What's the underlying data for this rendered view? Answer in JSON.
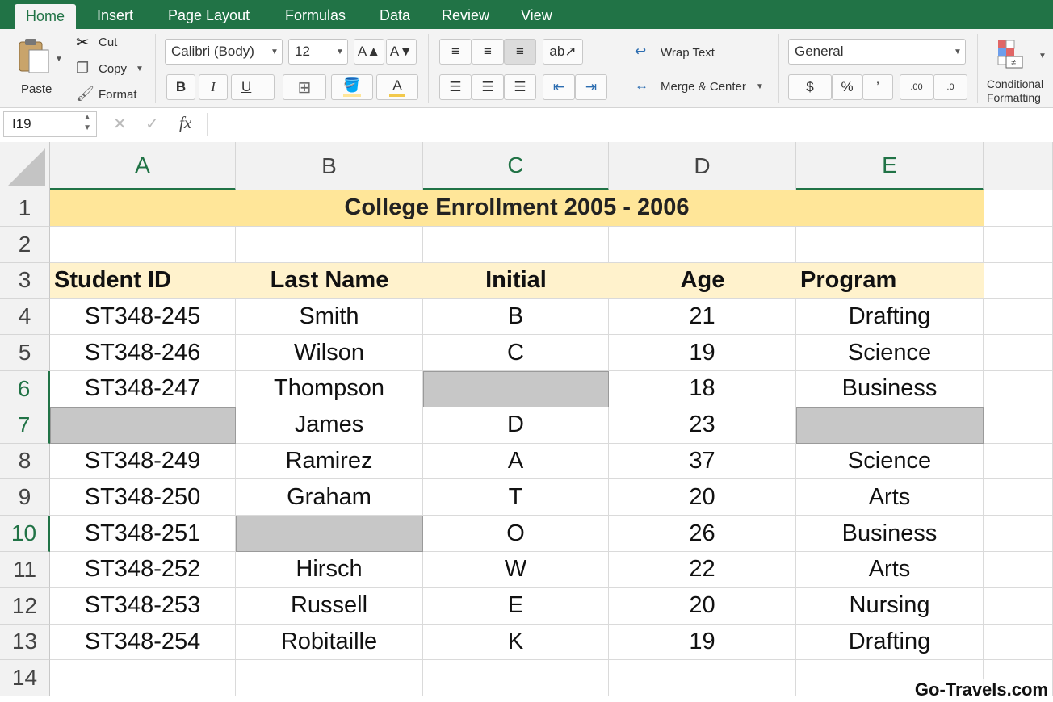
{
  "tabs": [
    "Home",
    "Insert",
    "Page Layout",
    "Formulas",
    "Data",
    "Review",
    "View"
  ],
  "active_tab": "Home",
  "ribbon": {
    "paste_label": "Paste",
    "cut_label": "Cut",
    "copy_label": "Copy",
    "format_label": "Format",
    "font_name": "Calibri (Body)",
    "font_size": "12",
    "bold_label": "B",
    "italic_label": "I",
    "underline_label": "U",
    "wrap_text_label": "Wrap Text",
    "merge_center_label": "Merge & Center",
    "number_format": "General",
    "currency_label": "$",
    "percent_label": "%",
    "comma_label": "’",
    "inc_decimal_label": ".00",
    "dec_decimal_label": ".0",
    "conditional_label_1": "Conditional",
    "conditional_label_2": "Formatting"
  },
  "formula_bar": {
    "name_box": "I19",
    "fx_label": "fx",
    "cancel_icon": "✕",
    "enter_icon": "✓",
    "content": ""
  },
  "columns": [
    "A",
    "B",
    "C",
    "D",
    "E"
  ],
  "rows": [
    "1",
    "2",
    "3",
    "4",
    "5",
    "6",
    "7",
    "8",
    "9",
    "10",
    "11",
    "12",
    "13",
    "14"
  ],
  "sheet": {
    "title": "College Enrollment 2005 - 2006",
    "headers": [
      "Student ID",
      "Last Name",
      "Initial",
      "Age",
      "Program"
    ],
    "data": [
      [
        "ST348-245",
        "Smith",
        "B",
        "21",
        "Drafting"
      ],
      [
        "ST348-246",
        "Wilson",
        "C",
        "19",
        "Science"
      ],
      [
        "ST348-247",
        "Thompson",
        "",
        "18",
        "Business"
      ],
      [
        "",
        "James",
        "D",
        "23",
        ""
      ],
      [
        "ST348-249",
        "Ramirez",
        "A",
        "37",
        "Science"
      ],
      [
        "ST348-250",
        "Graham",
        "T",
        "20",
        "Arts"
      ],
      [
        "ST348-251",
        "",
        "O",
        "26",
        "Business"
      ],
      [
        "ST348-252",
        "Hirsch",
        "W",
        "22",
        "Arts"
      ],
      [
        "ST348-253",
        "Russell",
        "E",
        "20",
        "Nursing"
      ],
      [
        "ST348-254",
        "Robitaille",
        "K",
        "19",
        "Drafting"
      ]
    ]
  },
  "watermark": "Go-Travels.com",
  "colors": {
    "ribbon_green": "#217346",
    "title_fill": "#ffe699",
    "header_fill": "#fff2cc",
    "blank_fill": "#c7c7c7"
  }
}
